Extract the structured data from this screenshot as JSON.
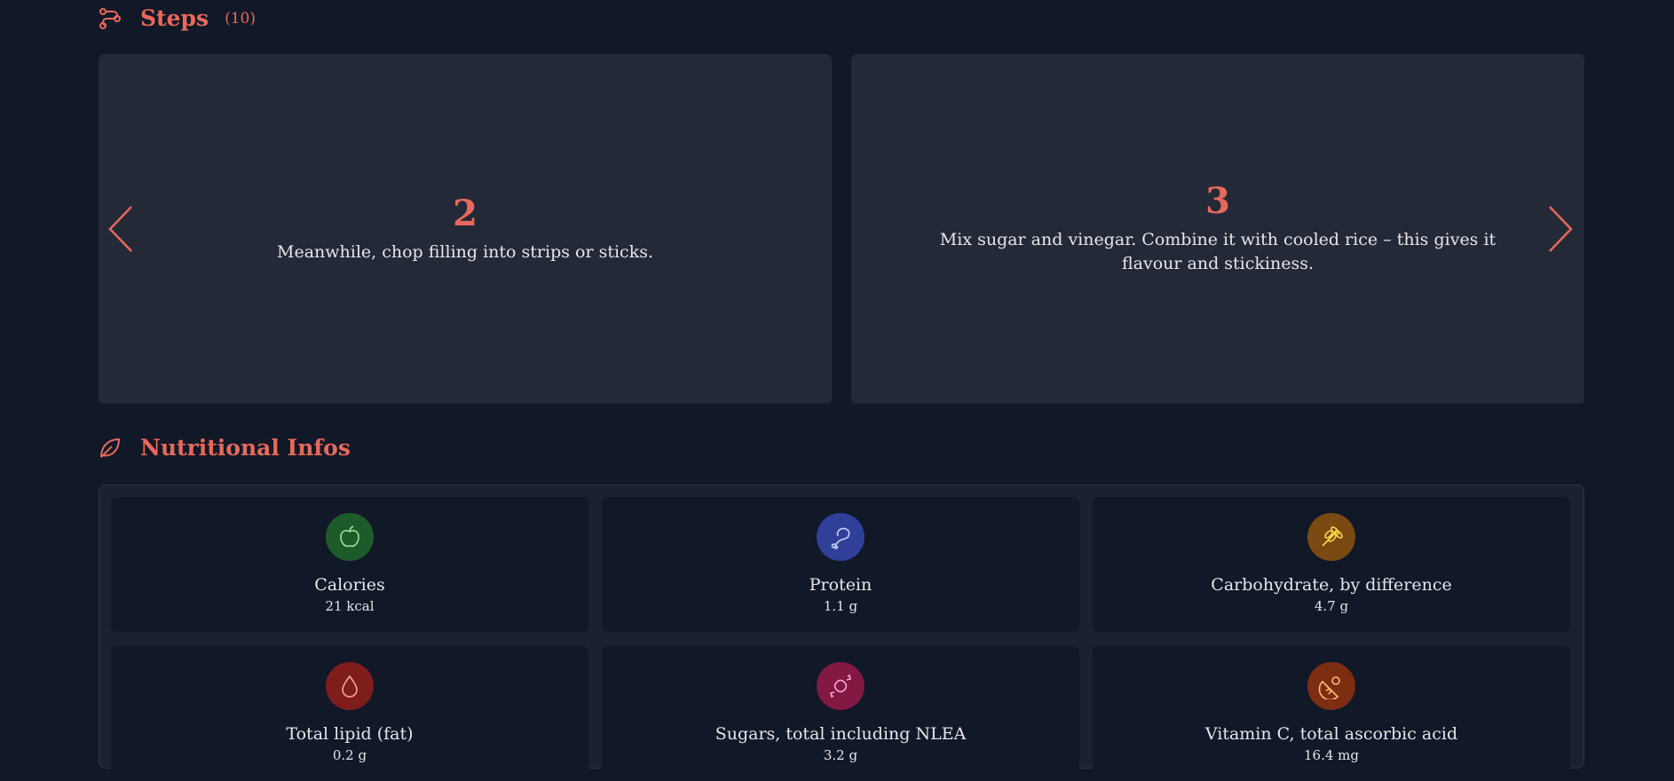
{
  "steps": {
    "title": "Steps",
    "count": "(10)",
    "icon": "route-icon",
    "cards": [
      {
        "number": "2",
        "text": "Meanwhile, chop filling into strips or sticks."
      },
      {
        "number": "3",
        "text": "Mix sugar and vinegar. Combine it with cooled rice – this gives it flavour and stickiness."
      }
    ],
    "prev_icon": "chevron-left-icon",
    "next_icon": "chevron-right-icon"
  },
  "nutrition": {
    "title": "Nutritional Infos",
    "icon": "leaf-icon",
    "items": [
      {
        "label": "Calories",
        "value": "21 kcal",
        "icon": "apple-icon",
        "bg": "#1f5a2b",
        "fg": "#9be39f"
      },
      {
        "label": "Protein",
        "value": "1.1 g",
        "icon": "meat-icon",
        "bg": "#2f3f9a",
        "fg": "#c7d2fe"
      },
      {
        "label": "Carbohydrate, by difference",
        "value": "4.7 g",
        "icon": "wheat-icon",
        "bg": "#7a4a12",
        "fg": "#fcd34d"
      },
      {
        "label": "Total lipid (fat)",
        "value": "0.2 g",
        "icon": "drop-icon",
        "bg": "#7f1d1d",
        "fg": "#fca5a5"
      },
      {
        "label": "Sugars, total including NLEA",
        "value": "3.2 g",
        "icon": "candy-icon",
        "bg": "#831843",
        "fg": "#f9a8d4"
      },
      {
        "label": "Vitamin C, total ascorbic acid",
        "value": "16.4 mg",
        "icon": "citrus-icon",
        "bg": "#7c2d12",
        "fg": "#fdba74"
      }
    ]
  },
  "colors": {
    "accent": "#e8695a",
    "background": "#111827",
    "card": "#242938"
  }
}
